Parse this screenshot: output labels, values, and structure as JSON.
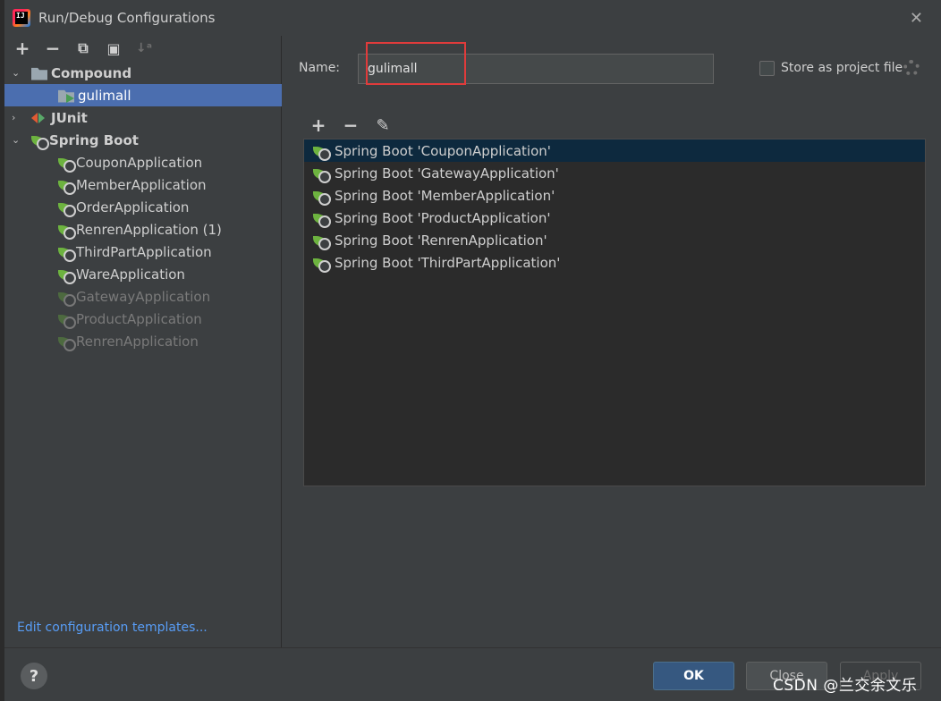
{
  "window": {
    "title": "Run/Debug Configurations"
  },
  "app_icon_text": "IJ",
  "toolbar": {
    "add": "+",
    "remove": "−",
    "copy": "⧉",
    "folder": "▣",
    "sort": "↓ᵃ"
  },
  "tree": [
    {
      "label": "Compound",
      "arrow": "⌄",
      "bold": true,
      "icon": "compound-icon",
      "indent": 0
    },
    {
      "label": "gulimall",
      "selected": true,
      "icon": "compound-run-icon",
      "indent": 1
    },
    {
      "label": "JUnit",
      "arrow": "›",
      "bold": true,
      "icon": "junit-icon",
      "indent": 0
    },
    {
      "label": "Spring Boot",
      "arrow": "⌄",
      "bold": true,
      "icon": "spring-boot-icon",
      "indent": 0
    },
    {
      "label": "CouponApplication",
      "icon": "spring-boot-icon",
      "indent": 1
    },
    {
      "label": "MemberApplication",
      "icon": "spring-boot-icon",
      "indent": 1
    },
    {
      "label": "OrderApplication",
      "icon": "spring-boot-icon",
      "indent": 1
    },
    {
      "label": "RenrenApplication (1)",
      "icon": "spring-boot-icon",
      "indent": 1
    },
    {
      "label": "ThirdPartApplication",
      "icon": "spring-boot-icon",
      "indent": 1
    },
    {
      "label": "WareApplication",
      "icon": "spring-boot-icon",
      "indent": 1
    },
    {
      "label": "GatewayApplication",
      "icon": "spring-boot-icon",
      "indent": 1,
      "dim": true
    },
    {
      "label": "ProductApplication",
      "icon": "spring-boot-icon",
      "indent": 1,
      "dim": true
    },
    {
      "label": "RenrenApplication",
      "icon": "spring-boot-icon",
      "indent": 1,
      "dim": true
    }
  ],
  "edit_templates_link": "Edit configuration templates...",
  "form": {
    "name_label": "Name:",
    "name_value": "gulimall",
    "store_label": "Store as project file"
  },
  "list_toolbar": {
    "add": "+",
    "remove": "−",
    "edit": "✎"
  },
  "configurations": [
    {
      "label": "Spring Boot 'CouponApplication'",
      "selected": true
    },
    {
      "label": "Spring Boot 'GatewayApplication'"
    },
    {
      "label": "Spring Boot 'MemberApplication'"
    },
    {
      "label": "Spring Boot 'ProductApplication'"
    },
    {
      "label": "Spring Boot 'RenrenApplication'"
    },
    {
      "label": "Spring Boot 'ThirdPartApplication'"
    }
  ],
  "buttons": {
    "help": "?",
    "ok": "OK",
    "close": "Close",
    "apply": "Apply"
  },
  "watermark": "CSDN @兰交余文乐",
  "colors": {
    "selection": "#4b6eaf",
    "list_selection": "#0d293e",
    "link": "#589df6",
    "highlight_box": "#e03b3b",
    "spring_green": "#6db33f"
  }
}
